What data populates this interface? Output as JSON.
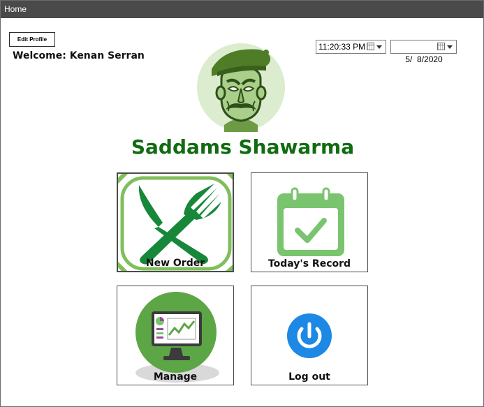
{
  "window": {
    "title": "Home"
  },
  "profile": {
    "edit_label": "Edit Profile",
    "welcome": "Welcome: Kenan Serran"
  },
  "pickers": {
    "time": "11:20:33 PM",
    "date": "5/  8/2020"
  },
  "brand": {
    "name": "Saddams Shawarma"
  },
  "tiles": {
    "new_order": "New Order",
    "todays_record": "Today's Record",
    "manage": "Manage",
    "logout": "Log out"
  },
  "colors": {
    "brand_green": "#116b11",
    "fork_green": "#17883a",
    "calendar_green": "#7ac46f",
    "manage_green": "#5ca646",
    "logout_blue": "#1e88e5"
  }
}
